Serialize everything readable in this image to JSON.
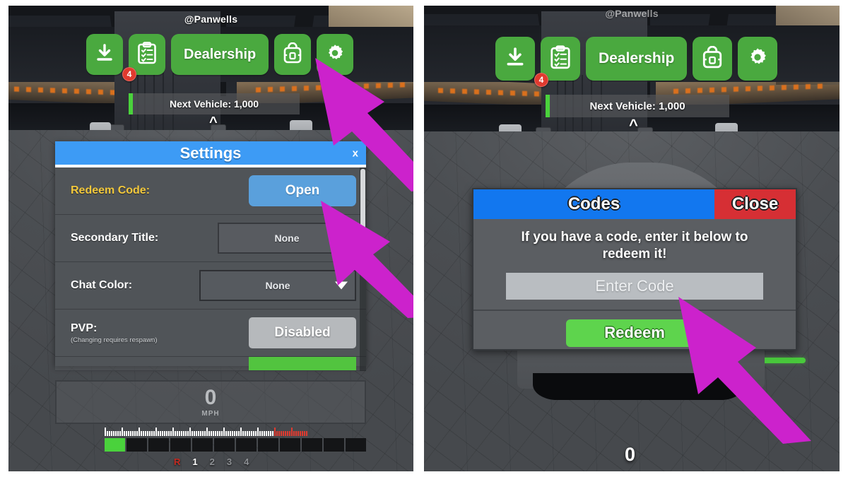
{
  "meta": {
    "accent_green": "#4aa93f",
    "accent_blue": "#3d9bf5",
    "codes_blue": "#1277ef",
    "close_red": "#d62f34",
    "redeem_green": "#5ed44d",
    "arrow_magenta": "#cc22cc",
    "gold_label": "#f2c83c"
  },
  "hud": {
    "username": "@Panwells",
    "toolbar": [
      {
        "name": "download-button",
        "icon": "download-icon",
        "label": ""
      },
      {
        "name": "quests-button",
        "icon": "clipboard-checklist-icon",
        "label": "",
        "badge": "4"
      },
      {
        "name": "dealership-button",
        "icon": "",
        "label": "Dealership"
      },
      {
        "name": "inventory-button",
        "icon": "backpack-icon",
        "label": ""
      },
      {
        "name": "settings-button",
        "icon": "gear-icon",
        "label": ""
      }
    ],
    "next_vehicle": "Next Vehicle: 1,000",
    "expand_chevron": "^"
  },
  "settings_dialog": {
    "title": "Settings",
    "close_label": "x",
    "rows": [
      {
        "label": "Redeem Code:",
        "sublabel": "",
        "control": "button",
        "value": "Open"
      },
      {
        "label": "Secondary Title:",
        "sublabel": "",
        "control": "field",
        "value": "None"
      },
      {
        "label": "Chat Color:",
        "sublabel": "",
        "control": "dropdown",
        "value": "None"
      },
      {
        "label": "PVP:",
        "sublabel": "(Changing requires respawn)",
        "control": "toggle",
        "value": "Disabled"
      }
    ]
  },
  "speedometer": {
    "speed": "0",
    "unit": "MPH",
    "gears": [
      "R",
      "1",
      "2",
      "3",
      "4"
    ],
    "active_gear": "1"
  },
  "right_speed": "0",
  "codes_dialog": {
    "title": "Codes",
    "close_label": "Close",
    "message": "If you have a code, enter it below to redeem it!",
    "input_placeholder": "Enter Code",
    "input_value": "",
    "redeem_label": "Redeem"
  },
  "annotations": [
    {
      "name": "arrow-to-settings-gear",
      "points_at": "settings-button"
    },
    {
      "name": "arrow-to-open-button",
      "points_at": "redeem-code-open-button"
    },
    {
      "name": "arrow-to-code-input",
      "points_at": "code-input-field"
    }
  ]
}
